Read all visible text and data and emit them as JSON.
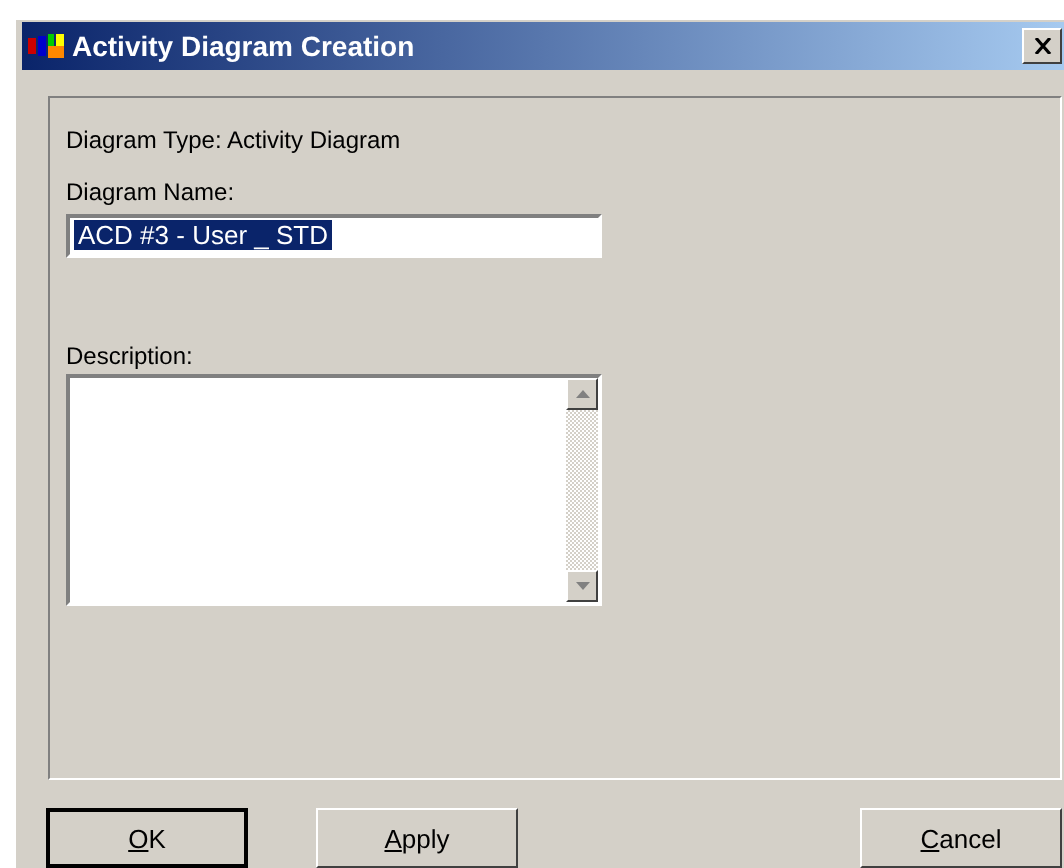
{
  "window": {
    "title": "Activity Diagram Creation"
  },
  "diagram_type": "Diagram Type: Activity Diagram",
  "name_field": {
    "label": "Diagram Name:",
    "value": "ACD #3 - User _ STD",
    "selected": true
  },
  "description_field": {
    "label": "Description:"
  },
  "buttons": [
    {
      "label": "OK",
      "default": true
    },
    {
      "label": "Apply",
      "default": false
    },
    {
      "label": "Cancel",
      "default": false
    }
  ]
}
